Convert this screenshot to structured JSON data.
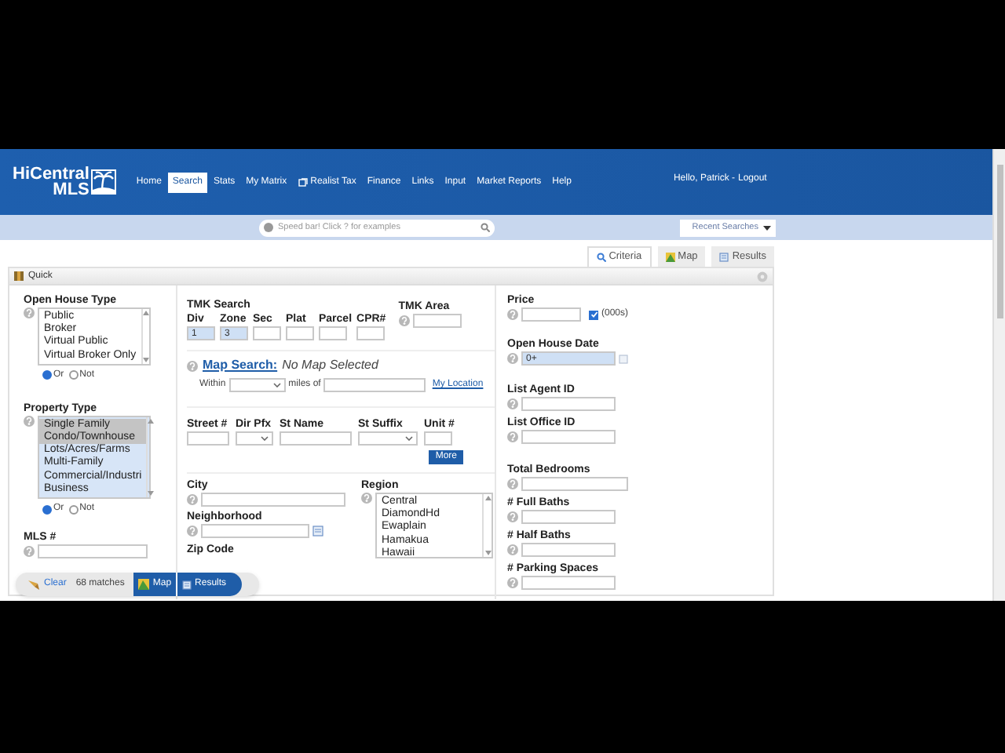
{
  "header": {
    "logo_line1": "HiCentral",
    "logo_line2": "MLS",
    "nav": [
      {
        "label": "Home",
        "selected": false
      },
      {
        "label": "Search",
        "selected": true
      },
      {
        "label": "Stats",
        "selected": false
      },
      {
        "label": "My Matrix",
        "selected": false
      },
      {
        "label": "Realist Tax",
        "selected": false,
        "kind": "external"
      },
      {
        "label": "Finance",
        "selected": false
      },
      {
        "label": "Links",
        "selected": false
      },
      {
        "label": "Input",
        "selected": false
      },
      {
        "label": "Market Reports",
        "selected": false
      },
      {
        "label": "Help",
        "selected": false
      }
    ],
    "greeting": "Hello, Patrick -",
    "logout": "Logout"
  },
  "speed_bar": {
    "placeholder": "Speed bar! Click ? for examples"
  },
  "recent_searches": "Recent Searches",
  "view_tabs": [
    {
      "label": "Criteria",
      "selected": true,
      "kind": "criteria"
    },
    {
      "label": "Map",
      "selected": false,
      "kind": "map"
    },
    {
      "label": "Results",
      "selected": false,
      "kind": "results"
    }
  ],
  "panel_title": "Quick",
  "open_house_type": {
    "label": "Open House Type",
    "filled": false,
    "options": [
      {
        "label": "Public",
        "selected": false
      },
      {
        "label": "Broker",
        "selected": false
      },
      {
        "label": "Virtual Public",
        "selected": false
      },
      {
        "label": "Virtual Broker Only",
        "selected": false
      }
    ],
    "mode": [
      {
        "label": "Or",
        "selected": true
      },
      {
        "label": "Not",
        "selected": false
      }
    ]
  },
  "property_type": {
    "label": "Property Type",
    "filled": true,
    "options": [
      {
        "label": "Single Family",
        "selected": true
      },
      {
        "label": "Condo/Townhouse",
        "selected": true
      },
      {
        "label": "Lots/Acres/Farms",
        "selected": false
      },
      {
        "label": "Multi-Family",
        "selected": false
      },
      {
        "label": "Commercial/Industri",
        "selected": false
      },
      {
        "label": "Business",
        "selected": false
      }
    ],
    "mode": [
      {
        "label": "Or",
        "selected": true
      },
      {
        "label": "Not",
        "selected": false
      }
    ]
  },
  "mls_number": {
    "label": "MLS #"
  },
  "tmk": {
    "label": "TMK Search",
    "parts": [
      {
        "label": "Div",
        "value": "1",
        "filled": true
      },
      {
        "label": "Zone",
        "value": "3",
        "filled": true
      },
      {
        "label": "Sec",
        "filled": false
      },
      {
        "label": "Plat",
        "filled": false
      },
      {
        "label": "Parcel",
        "filled": false
      },
      {
        "label": "CPR#",
        "filled": false
      }
    ],
    "area_label": "TMK Area"
  },
  "map_search": {
    "link": "Map Search:",
    "status": "No Map Selected",
    "within": "Within",
    "miles_of": "miles of",
    "my_location": "My Location"
  },
  "address": [
    {
      "label": "Street #",
      "kind": "text"
    },
    {
      "label": "Dir Pfx",
      "kind": "select"
    },
    {
      "label": "St Name",
      "kind": "text"
    },
    {
      "label": "St Suffix",
      "kind": "select"
    },
    {
      "label": "Unit #",
      "kind": "text"
    }
  ],
  "more_button": "More",
  "city": {
    "label": "City"
  },
  "neighborhood": {
    "label": "Neighborhood"
  },
  "zip_code": {
    "label": "Zip Code"
  },
  "region": {
    "label": "Region",
    "options": [
      {
        "label": "Central",
        "selected": false
      },
      {
        "label": "DiamondHd",
        "selected": false
      },
      {
        "label": "Ewaplain",
        "selected": false
      },
      {
        "label": "Hamakua",
        "selected": false
      },
      {
        "label": "Hawaii",
        "selected": false
      }
    ]
  },
  "price": {
    "label": "Price",
    "checked": true,
    "unit": "(000s)"
  },
  "open_house_date": {
    "label": "Open House Date",
    "value": "0+",
    "filled": true
  },
  "right_fields": [
    {
      "label": "List Agent ID"
    },
    {
      "label": "List Office ID"
    },
    {
      "label": "Total Bedrooms"
    },
    {
      "label": "# Full Baths"
    },
    {
      "label": "# Half Baths"
    },
    {
      "label": "# Parking Spaces"
    }
  ],
  "bottom_bar": {
    "clear": "Clear",
    "matches": "68 matches",
    "map": "Map",
    "results": "Results"
  }
}
